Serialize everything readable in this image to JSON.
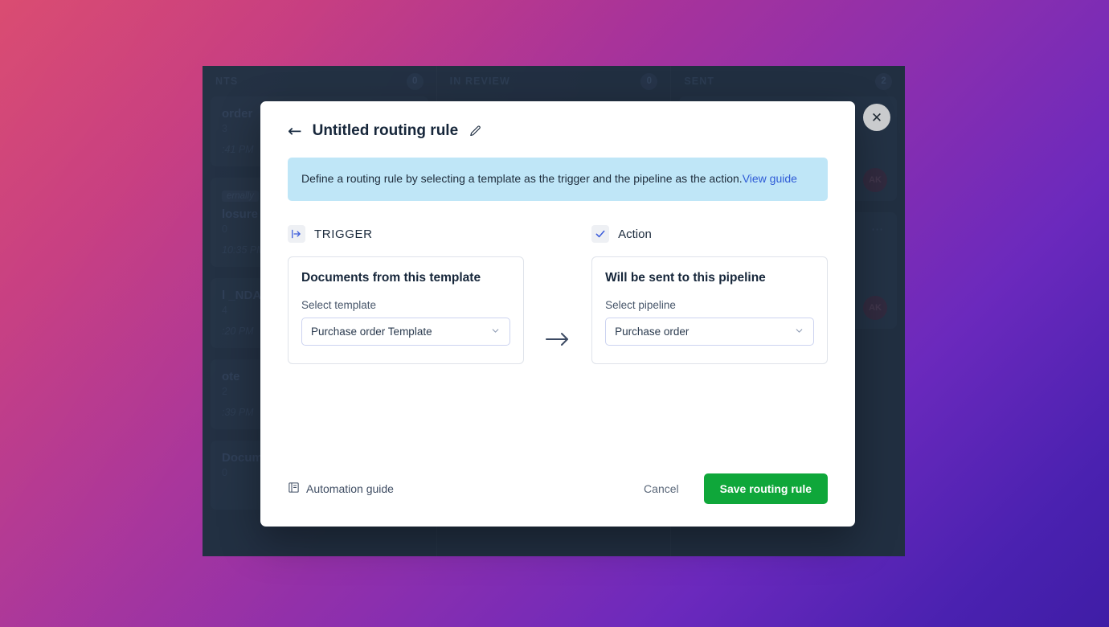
{
  "background_app": {
    "columns": [
      {
        "title": "NTS",
        "count": "0",
        "cards": [
          {
            "tag": "",
            "title": "order",
            "sub": "3",
            "time": ":41 PM",
            "avatar": "",
            "kebab": false,
            "plus": false
          },
          {
            "tag": "ernally",
            "title": "losure Agr",
            "sub": "0",
            "time": "10:35 PM",
            "avatar": "",
            "kebab": false,
            "plus": false
          },
          {
            "tag": "",
            "title": "l _NDA",
            "sub": "4",
            "time": ":20 PM",
            "avatar": "",
            "kebab": false,
            "plus": false
          },
          {
            "tag": "",
            "title": "ote",
            "sub": "2",
            "time": ":39 PM",
            "avatar": "",
            "kebab": false,
            "plus": false
          },
          {
            "tag": "",
            "title": "Document",
            "sub": "0",
            "time": "",
            "avatar": "",
            "kebab": false,
            "plus": true
          }
        ]
      },
      {
        "title": "IN REVIEW",
        "count": "0",
        "cards": []
      },
      {
        "title": "SENT",
        "count": "2",
        "cards": [
          {
            "tag": "",
            "title": "",
            "sub": "",
            "time": "",
            "avatar": "AK",
            "kebab": false,
            "plus": false
          },
          {
            "tag": "",
            "title": "",
            "sub": "",
            "time": "",
            "avatar": "AK",
            "kebab": true,
            "plus": false
          }
        ]
      }
    ]
  },
  "modal": {
    "back_arrow": "←",
    "title": "Untitled routing rule",
    "close_label": "✕",
    "info": {
      "text": "Define a routing rule by selecting a template as the trigger and the pipeline as the action.",
      "link_text": "View guide"
    },
    "trigger": {
      "label": "TRIGGER",
      "box_title": "Documents from this template",
      "field_label": "Select template",
      "selected": "Purchase order Template",
      "chevron": "⌄"
    },
    "flow_arrow": "→",
    "action": {
      "label": "Action",
      "box_title": "Will be sent to this pipeline",
      "field_label": "Select pipeline",
      "selected": "Purchase order",
      "chevron": "⌄"
    },
    "footer": {
      "automation_guide": "Automation guide",
      "cancel": "Cancel",
      "save": "Save routing rule"
    }
  },
  "colors": {
    "accent_blue": "#3b5bdb",
    "save_green": "#0fa73a",
    "info_banner": "#bfe6f7",
    "link_blue": "#2e5bd6",
    "app_bg": "#27364b"
  }
}
